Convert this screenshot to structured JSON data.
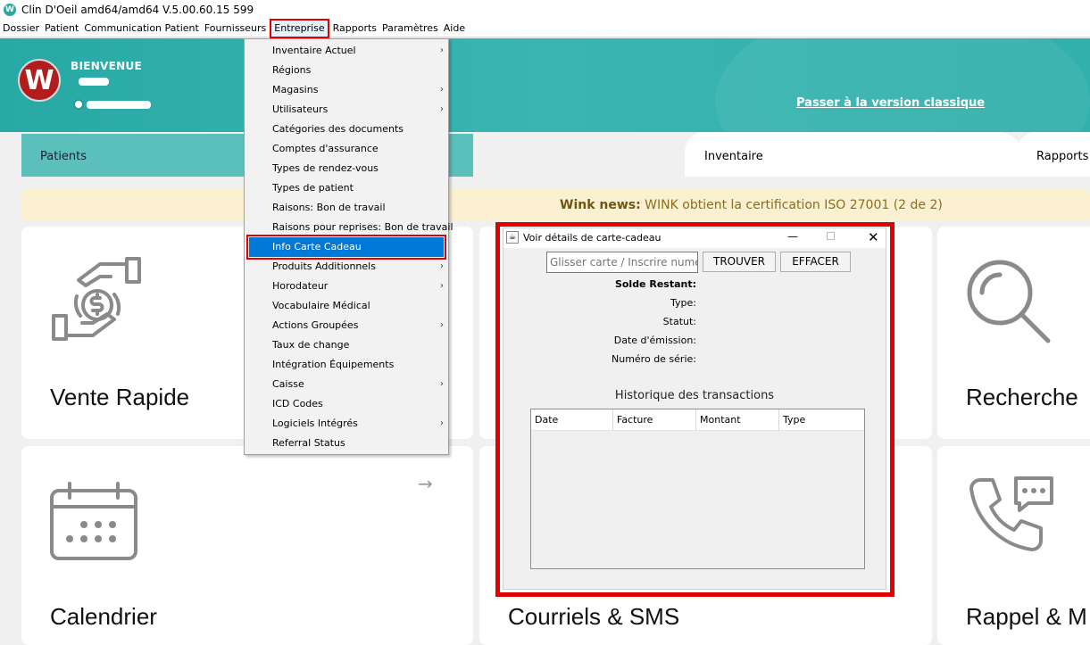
{
  "window": {
    "title": "Clin D'Oeil amd64/amd64 V.5.00.60.15 599"
  },
  "menubar": [
    "Dossier",
    "Patient",
    "Communication Patient",
    "Fournisseurs",
    "Entreprise",
    "Rapports",
    "Paramètres",
    "Aide"
  ],
  "header": {
    "welcome": "BIENVENUE",
    "classic_link": "Passer à la version classique"
  },
  "tabs": {
    "patients": "Patients",
    "inventaire": "Inventaire",
    "rapports": "Rapports"
  },
  "news": {
    "label": "Wink news:",
    "text": " WINK obtient la certification ISO 27001 (2 de 2)"
  },
  "cards": {
    "vente": "Vente Rapide",
    "recherche": "Recherche",
    "calendrier": "Calendrier",
    "courriels": "Courriels & SMS",
    "rappel": "Rappel & M"
  },
  "dropdown": [
    {
      "label": "Inventaire Actuel",
      "sub": true
    },
    {
      "label": "Régions",
      "sub": false
    },
    {
      "label": "Magasins",
      "sub": true
    },
    {
      "label": "Utilisateurs",
      "sub": true
    },
    {
      "label": "Catégories des documents",
      "sub": false
    },
    {
      "label": "Comptes d'assurance",
      "sub": false
    },
    {
      "label": "Types de rendez-vous",
      "sub": false
    },
    {
      "label": "Types de patient",
      "sub": false
    },
    {
      "label": "Raisons: Bon de travail",
      "sub": false
    },
    {
      "label": "Raisons pour reprises: Bon de travail",
      "sub": false
    },
    {
      "label": "Info Carte Cadeau",
      "sub": false
    },
    {
      "label": "Produits Additionnels",
      "sub": true
    },
    {
      "label": "Horodateur",
      "sub": true
    },
    {
      "label": "Vocabulaire Médical",
      "sub": false
    },
    {
      "label": "Actions Groupées",
      "sub": true
    },
    {
      "label": "Taux de change",
      "sub": false
    },
    {
      "label": "Intégration Équipements",
      "sub": false
    },
    {
      "label": "Caisse",
      "sub": true
    },
    {
      "label": "ICD Codes",
      "sub": false
    },
    {
      "label": "Logiciels Intégrés",
      "sub": true
    },
    {
      "label": "Referral Status",
      "sub": false
    }
  ],
  "dialog": {
    "title": "Voir détails de carte-cadeau",
    "search_placeholder": "Glisser carte / Inscrire numéro",
    "find": "TROUVER",
    "clear": "EFFACER",
    "labels": {
      "balance": "Solde Restant:",
      "type": "Type:",
      "status": "Statut:",
      "issue_date": "Date d'émission:",
      "serial": "Numéro de série:"
    },
    "history_title": "Historique des transactions",
    "columns": [
      "Date",
      "Facture",
      "Montant",
      "Type"
    ]
  },
  "colors": {
    "header_teal": "#31b0ac",
    "highlight_red": "#e00000",
    "menu_selection": "#0078d7"
  }
}
